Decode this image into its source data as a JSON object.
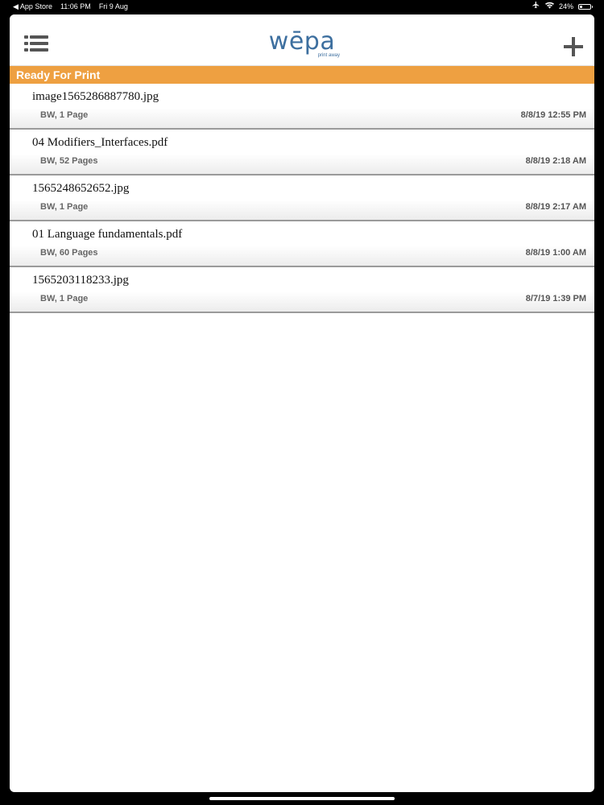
{
  "status_bar": {
    "back_label": "◀ App Store",
    "time": "11:06 PM",
    "date": "Fri 9 Aug",
    "battery": "24%",
    "battery_level": 0.24
  },
  "nav": {
    "logo_text": "wēpa",
    "logo_tagline": "print away"
  },
  "section": {
    "title": "Ready For Print"
  },
  "files": [
    {
      "name": "image1565286887780.jpg",
      "details": "BW, 1 Page",
      "date": "8/8/19 12:55 PM"
    },
    {
      "name": "04 Modifiers_Interfaces.pdf",
      "details": "BW, 52 Pages",
      "date": "8/8/19 2:18 AM"
    },
    {
      "name": "1565248652652.jpg",
      "details": "BW, 1 Page",
      "date": "8/8/19 2:17 AM"
    },
    {
      "name": "01 Language fundamentals.pdf",
      "details": "BW, 60 Pages",
      "date": "8/8/19 1:00 AM"
    },
    {
      "name": "1565203118233.jpg",
      "details": "BW, 1 Page",
      "date": "8/7/19 1:39 PM"
    }
  ],
  "icons": {
    "menu": "list-menu-icon",
    "add": "plus-icon",
    "airplane": "airplane-icon",
    "wifi": "wifi-icon",
    "battery": "battery-icon"
  }
}
